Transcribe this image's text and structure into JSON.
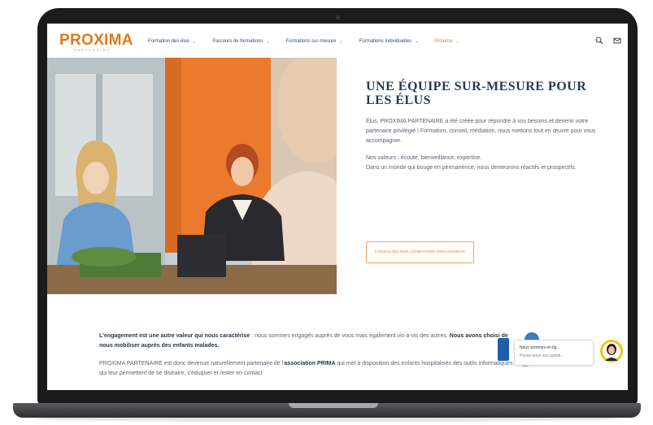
{
  "nav": {
    "logo_text": "PROXIMA",
    "logo_subtitle": "PARTENAIRE",
    "items": [
      {
        "label": "Formation des élus"
      },
      {
        "label": "Parcours de formations"
      },
      {
        "label": "Formations sur-mesure"
      },
      {
        "label": "Formations individuelles"
      },
      {
        "label": "Proxima"
      }
    ],
    "icons": [
      "search-icon",
      "mail-icon"
    ]
  },
  "hero": {
    "title": "UNE ÉQUIPE SUR-MESURE  POUR LES ÉLUS",
    "p1": "Élus, PROXIMA PARTENAIRE a été créée pour répondre à vos besoins et devenir votre partenaire privilégié ! Formation, conseil, médiation, nous mettons tout en œuvre pour vous accompagner.",
    "p2_line1": "Nos valeurs : écoute, bienveillance, expertise.",
    "p2_line2": "Dans un monde qui bouge en permanence, nous demeurons réactifs et prospectifs.",
    "cta_label": "CONSULTEZ NOS CONDITIONS ENGAGEMENT"
  },
  "lower": {
    "p1_bold": "L'engagement est une autre valeur qui nous caractérise",
    "p1_text": " : nous sommes engagés auprès de vous mais également vis-à-vis des autres. ",
    "p1_bold2": "Nous avons choisi de nous mobiliser auprès des enfants malades.",
    "p2_start": "PROXIMA PARTENAIRE est donc devenue naturellement partenaire de l'",
    "p2_bold": "association PRIMA",
    "p2_end": " qui met à disposition des enfants hospitalisés des outils informatiques qui leur permettent de se distraire, s'éduquer et rester en contact"
  },
  "chat": {
    "line1": "Nous sommes en lig...",
    "line2": "Posez-nous vos questi..."
  },
  "colors": {
    "brand_orange": "#e0781c",
    "brand_navy": "#1f3a57"
  }
}
